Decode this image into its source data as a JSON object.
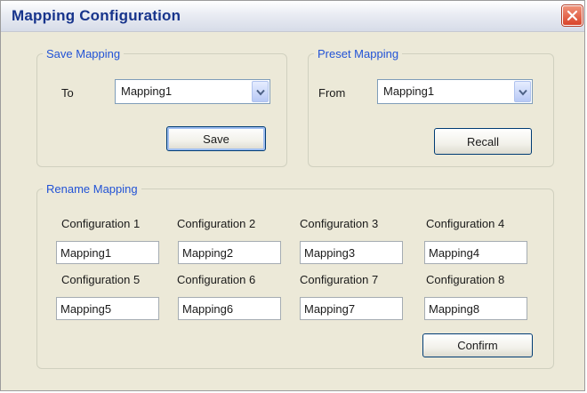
{
  "window": {
    "title": "Mapping Configuration"
  },
  "save_mapping": {
    "legend": "Save Mapping",
    "to_label": "To",
    "selected": "Mapping1",
    "save_label": "Save"
  },
  "preset_mapping": {
    "legend": "Preset Mapping",
    "from_label": "From",
    "selected": "Mapping1",
    "recall_label": "Recall"
  },
  "rename_mapping": {
    "legend": "Rename Mapping",
    "configs": [
      {
        "label": "Configuration 1",
        "value": "Mapping1"
      },
      {
        "label": "Configuration 2",
        "value": "Mapping2"
      },
      {
        "label": "Configuration 3",
        "value": "Mapping3"
      },
      {
        "label": "Configuration 4",
        "value": "Mapping4"
      },
      {
        "label": "Configuration 5",
        "value": "Mapping5"
      },
      {
        "label": "Configuration 6",
        "value": "Mapping6"
      },
      {
        "label": "Configuration 7",
        "value": "Mapping7"
      },
      {
        "label": "Configuration 8",
        "value": "Mapping8"
      }
    ],
    "confirm_label": "Confirm"
  },
  "icons": {
    "close": "close-icon",
    "dropdown": "chevron-down-icon"
  },
  "colors": {
    "title_text": "#17348c",
    "legend_text": "#2253d6",
    "window_bg": "#ece9d8",
    "close_button": "#d9442a"
  }
}
